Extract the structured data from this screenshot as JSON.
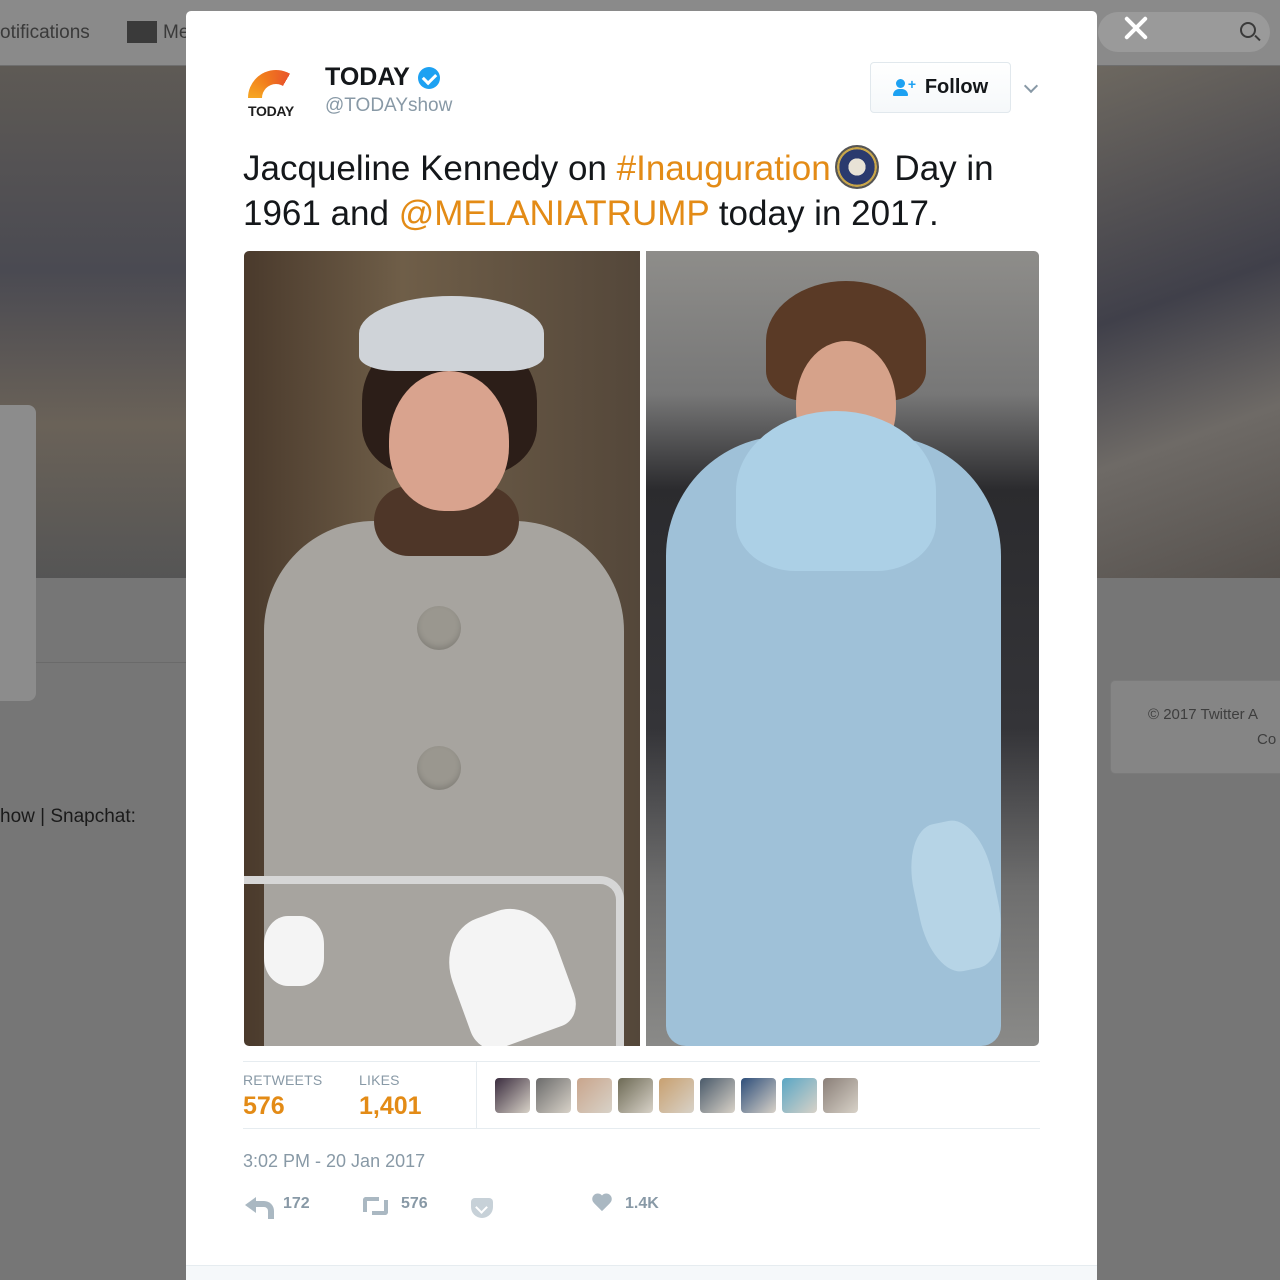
{
  "background": {
    "nav": {
      "notifications_label": "otifications",
      "messages_label": "Me"
    },
    "copyright": {
      "line1": "© 2017 Twitter   A",
      "line2": "Co"
    },
    "bio_fragment": "how | Snapchat:"
  },
  "tweet": {
    "author": {
      "avatar_text": "TODAY",
      "name": "TODAY",
      "handle": "@TODAYshow",
      "verified": true
    },
    "follow_label": "Follow",
    "text": {
      "part1": "Jacqueline Kennedy on ",
      "hashtag": "#Inauguration",
      "part2": " Day in 1961 and ",
      "mention": "@MELANIATRUMP",
      "part3": " today in 2017."
    },
    "stats": {
      "retweets_label": "RETWEETS",
      "retweets_value": "576",
      "likes_label": "LIKES",
      "likes_value": "1,401"
    },
    "likers": [
      "#3a2c3e",
      "#6b6b6b",
      "#c9a58c",
      "#6d6a55",
      "#c8a070",
      "#4a5a6a",
      "#2d4e7a",
      "#5aa6c4",
      "#8a7f78"
    ],
    "timestamp": "3:02 PM - 20 Jan 2017",
    "actions": {
      "reply_count": "172",
      "retweet_count": "576",
      "like_count": "1.4K"
    }
  },
  "colors": {
    "accent": "#e38b16",
    "verified": "#1da1f2",
    "muted": "#8899a6"
  }
}
